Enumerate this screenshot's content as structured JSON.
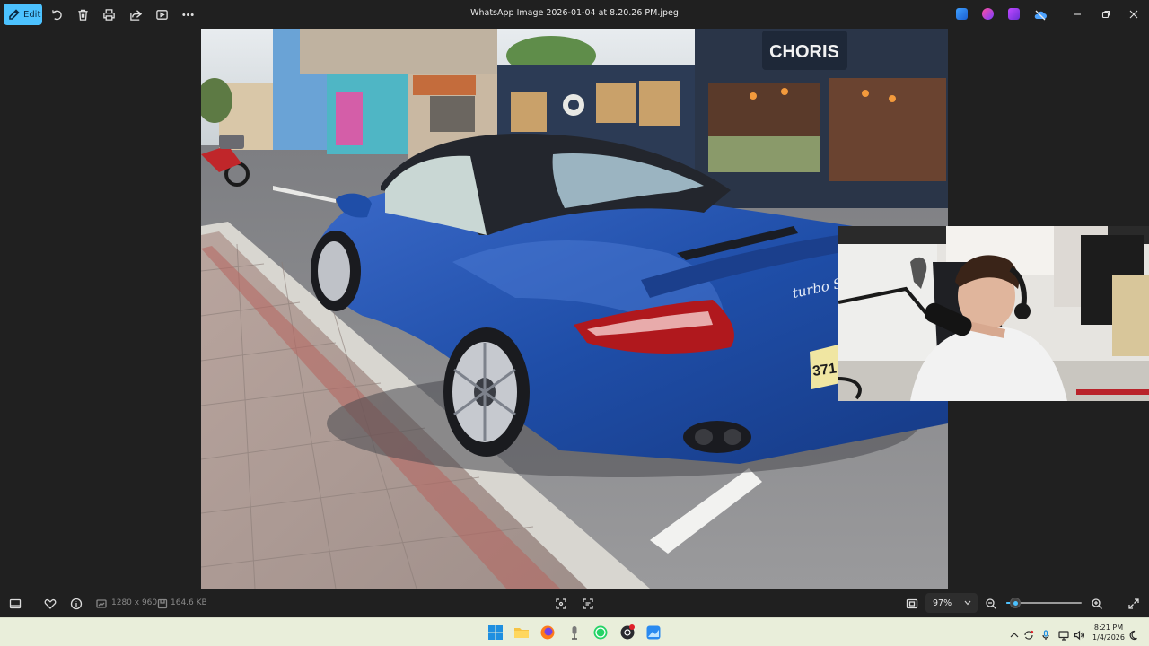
{
  "toolbar": {
    "edit_label": "Edit",
    "title": "WhatsApp Image 2026-01-04 at 8.20.26 PM.jpeg",
    "accent_color": "#4cc2ff"
  },
  "status": {
    "dimensions": "1280 x 960",
    "file_size": "164.6 KB",
    "zoom_label": "97%",
    "zoom_level_fraction": 0.12
  },
  "photo": {
    "shop_sign": "CHORIS",
    "car_badge": "turbo S",
    "plate_fragment": "371"
  },
  "taskbar": {
    "time": "8:21 PM",
    "date": "1/4/2026",
    "apps": [
      "windows-start",
      "file-explorer",
      "firefox",
      "microphone-app",
      "whatsapp",
      "obs-studio",
      "photos"
    ]
  }
}
